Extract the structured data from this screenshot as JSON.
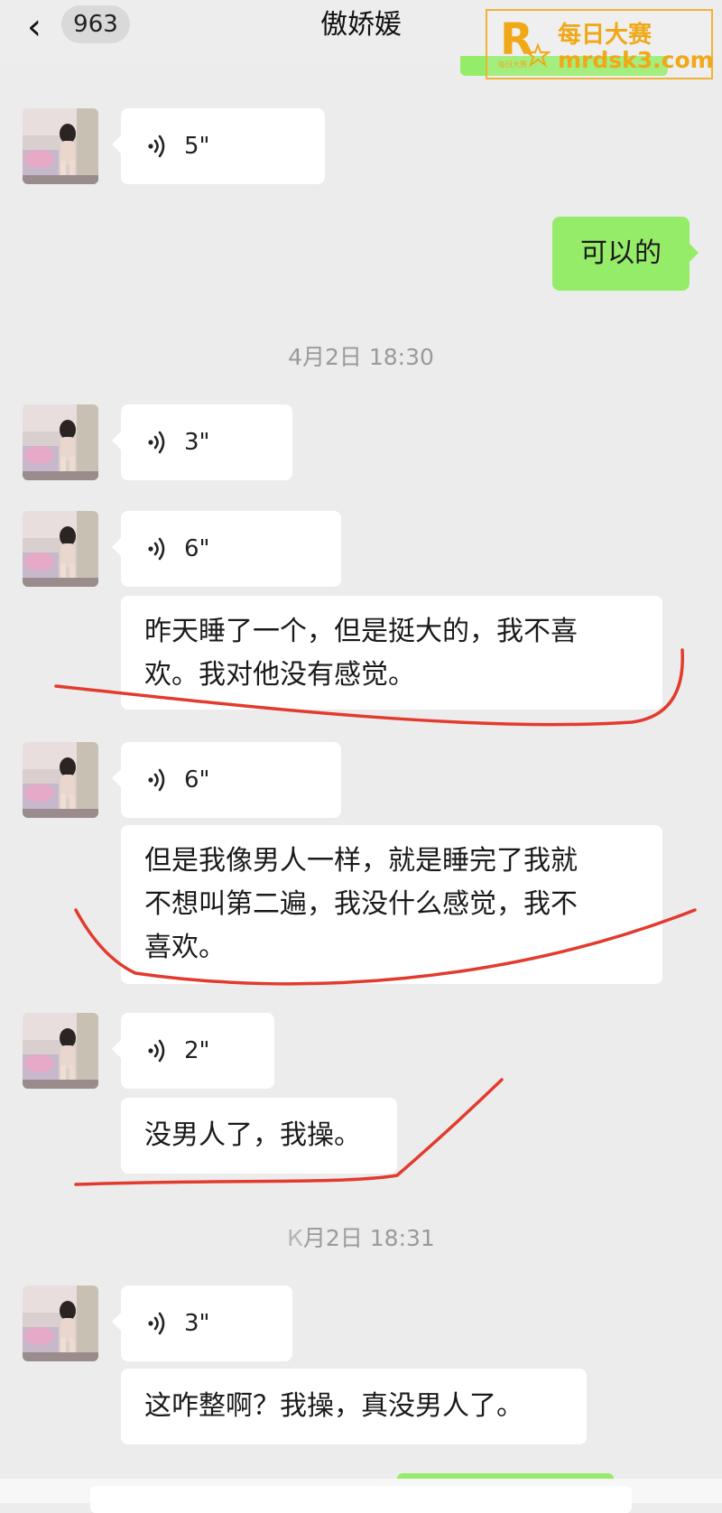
{
  "header": {
    "back_icon": "chevron-left-icon",
    "unread_count": "963",
    "title": "傲娇媛"
  },
  "watermark": {
    "logo_letter": "R",
    "logo_small": "每日大赛",
    "name_cn": "每日大赛",
    "url": "mrdsk3.com",
    "color": "#f0a818"
  },
  "messages": {
    "m1": {
      "duration": "5\""
    },
    "m2": {
      "text": "可以的"
    },
    "ts1": "4月2日 18:30",
    "m3": {
      "duration": "3\""
    },
    "m4": {
      "duration": "6\""
    },
    "m5": {
      "line1": "昨天睡了一个，但是挺大的，我不喜",
      "line2": "欢。我对他没有感觉。"
    },
    "m6": {
      "duration": "6\""
    },
    "m7": {
      "line1": "但是我像男人一样，就是睡完了我就",
      "line2": "不想叫第二遍，我没什么感觉，我不",
      "line3": "喜欢。"
    },
    "m8": {
      "duration": "2\""
    },
    "m9": {
      "text": "没男人了，我操。"
    },
    "ts2": "月2日 18:31",
    "m10": {
      "duration": "3\""
    },
    "m11": {
      "text": "这咋整啊？我操，真没男人了。"
    }
  },
  "colors": {
    "self_bubble": "#95ec69",
    "other_bubble": "#ffffff",
    "background": "#ececec",
    "annotation": "#e23b2e"
  }
}
